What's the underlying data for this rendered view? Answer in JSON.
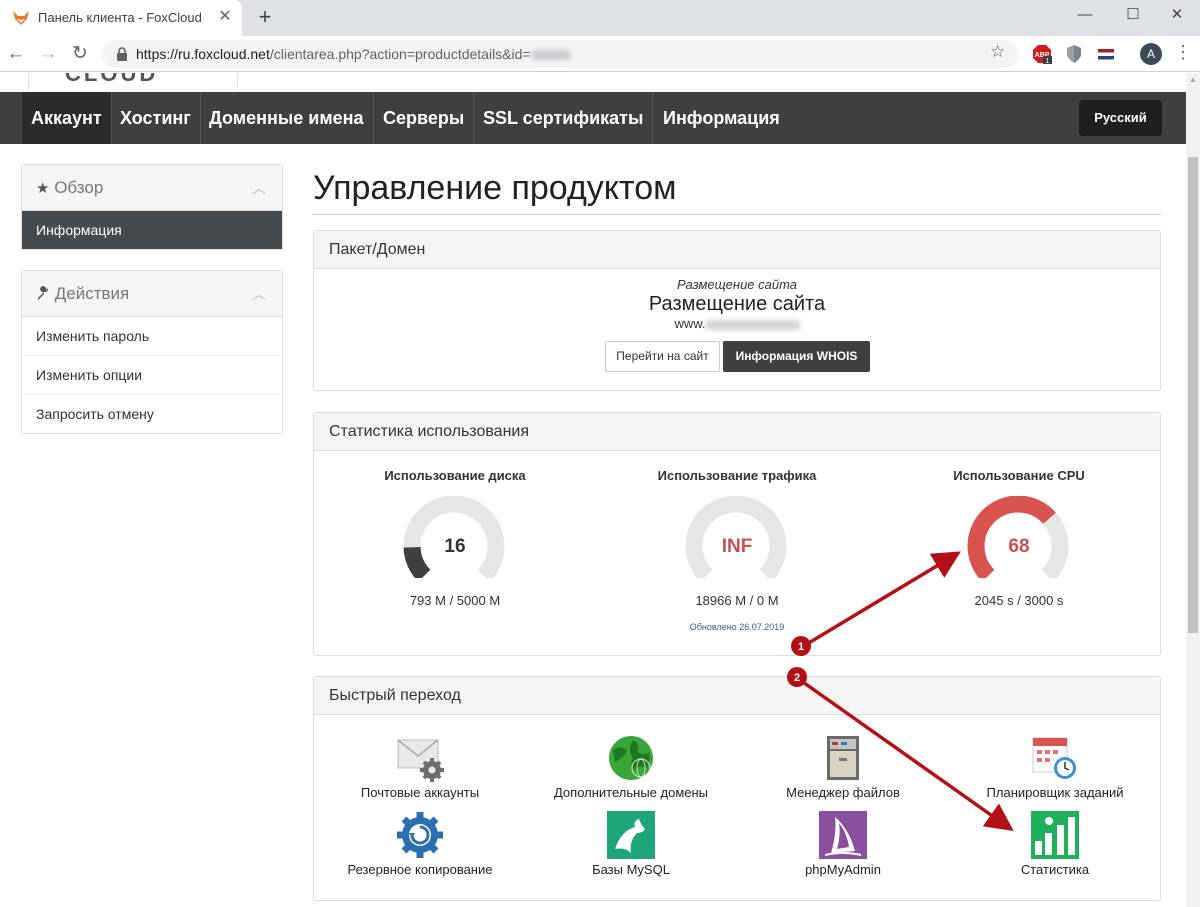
{
  "browser": {
    "tab_title": "Панель клиента - FoxCloud",
    "url_host": "https://ru.foxcloud.net",
    "url_path": "/clientarea.php?action=productdetails&id=",
    "avatar_letter": "A",
    "abp_badge": "1"
  },
  "nav": {
    "items": [
      "Аккаунт",
      "Хостинг",
      "Доменные имена",
      "Серверы",
      "SSL сертификаты",
      "Информация"
    ],
    "language": "Русский"
  },
  "sidebar": {
    "overview": {
      "title": "Обзор",
      "active_item": "Информация"
    },
    "actions": {
      "title": "Действия",
      "items": [
        "Изменить пароль",
        "Изменить опции",
        "Запросить отмену"
      ]
    }
  },
  "page": {
    "title": "Управление продуктом"
  },
  "package": {
    "header": "Пакет/Домен",
    "group": "Размещение сайта",
    "name": "Размещение сайта",
    "domain_prefix": "www.",
    "btn_visit": "Перейти на сайт",
    "btn_whois": "Информация WHOIS"
  },
  "usage": {
    "header": "Статистика использования",
    "updated": "Обновлено 26.07.2019",
    "gauges": [
      {
        "title": "Использование диска",
        "value": "16",
        "detail": "793 M / 5000 M",
        "percent": 16,
        "color": "#3f3f3f"
      },
      {
        "title": "Использование трафика",
        "value": "INF",
        "detail": "18966 M / 0 M",
        "percent": 0,
        "color": "#c9514c"
      },
      {
        "title": "Использование CPU",
        "value": "68",
        "detail": "2045 s / 3000 s",
        "percent": 68,
        "color": "#d9534f"
      }
    ]
  },
  "quick": {
    "header": "Быстрый переход",
    "items": [
      {
        "label": "Почтовые аккаунты",
        "icon": "mail-gear-icon"
      },
      {
        "label": "Дополнительные домены",
        "icon": "globe-icon"
      },
      {
        "label": "Менеджер файлов",
        "icon": "file-cabinet-icon"
      },
      {
        "label": "Планировщик заданий",
        "icon": "calendar-clock-icon"
      },
      {
        "label": "Резервное копирование",
        "icon": "backup-gear-icon"
      },
      {
        "label": "Базы MySQL",
        "icon": "mysql-dolphin-icon"
      },
      {
        "label": "phpMyAdmin",
        "icon": "phpmyadmin-sail-icon"
      },
      {
        "label": "Статистика",
        "icon": "statistics-chart-icon"
      }
    ]
  },
  "annotations": {
    "marker1": "1",
    "marker2": "2",
    "color": "#b30f16"
  }
}
